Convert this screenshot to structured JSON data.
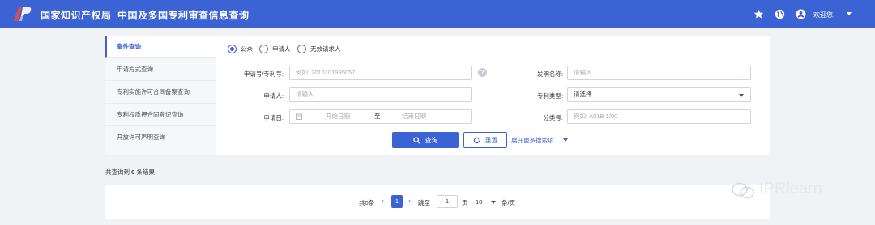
{
  "header": {
    "brand": "国家知识产权局",
    "title": "中国及多国专利审查信息查询",
    "welcome": "欢迎您,"
  },
  "sidenav": {
    "items": [
      {
        "label": "案件查询",
        "active": true
      },
      {
        "label": "申请方式查询",
        "active": false
      },
      {
        "label": "专利实施许可合同备案查询",
        "active": false
      },
      {
        "label": "专利权质押合同登记查询",
        "active": false
      },
      {
        "label": "开放许可声明查询",
        "active": false
      }
    ]
  },
  "form": {
    "radios": [
      {
        "label": "公众",
        "checked": true
      },
      {
        "label": "申请人",
        "checked": false
      },
      {
        "label": "无效请求人",
        "checked": false
      }
    ],
    "app_no_label": "申请号/专利号:",
    "app_no_placeholder": "例如: 2010101995057",
    "help": "?",
    "invention_name_label": "发明名称:",
    "invention_name_placeholder": "请输入",
    "applicant_label": "申请人:",
    "applicant_placeholder": "请输入",
    "patent_type_label": "专利类型:",
    "patent_type_value": "请选择",
    "app_date_label": "申请日:",
    "start_date_placeholder": "开始日期",
    "date_sep": "至",
    "end_date_placeholder": "结束日期",
    "class_no_label": "分类号:",
    "class_no_placeholder": "例如: A01B 1/00",
    "search_button": "查询",
    "reset_button": "重置",
    "more_link": "展开更多搜索项"
  },
  "result": {
    "prefix": "共查询到",
    "count": "0",
    "suffix": "条结果"
  },
  "pagination": {
    "total": "共0条",
    "current_page": "1",
    "jump_label": "跳至",
    "jump_value": "1",
    "page_unit": "页",
    "page_size": "10",
    "per_page": "条/页"
  },
  "watermark": "IPRlearn",
  "colors": {
    "accent": "#3b63d3",
    "background": "#f0f2f6"
  }
}
